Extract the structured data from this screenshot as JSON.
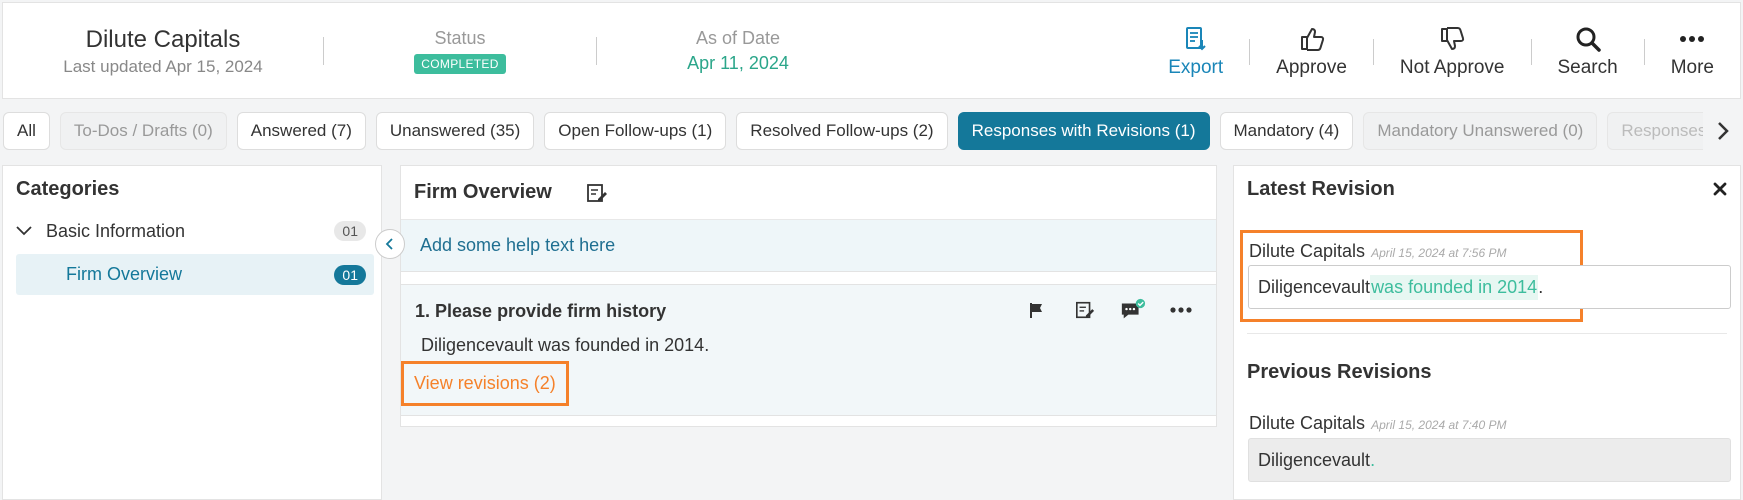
{
  "header": {
    "company": "Dilute Capitals",
    "last_updated": "Last updated Apr 15, 2024",
    "status_label": "Status",
    "status_value": "COMPLETED",
    "date_label": "As of Date",
    "date_value": "Apr 11, 2024",
    "actions": {
      "export": "Export",
      "approve": "Approve",
      "not_approve": "Not Approve",
      "search": "Search",
      "more": "More"
    }
  },
  "tabs": [
    {
      "label": "All"
    },
    {
      "label": "To-Dos / Drafts (0)"
    },
    {
      "label": "Answered (7)"
    },
    {
      "label": "Unanswered (35)"
    },
    {
      "label": "Open Follow-ups (1)"
    },
    {
      "label": "Resolved Follow-ups (2)"
    },
    {
      "label": "Responses with Revisions (1)"
    },
    {
      "label": "Mandatory (4)"
    },
    {
      "label": "Mandatory Unanswered (0)"
    },
    {
      "label": "Responses"
    }
  ],
  "categories": {
    "title": "Categories",
    "group": {
      "name": "Basic Information",
      "count": "01"
    },
    "item": {
      "name": "Firm Overview",
      "count": "01"
    }
  },
  "section": {
    "title": "Firm Overview",
    "help_text": "Add some help text here",
    "question": {
      "title": "1.  Please provide firm history",
      "answer": "Diligencevault was founded in 2014.",
      "revisions_link": "View revisions (2)"
    }
  },
  "revisions": {
    "latest_title": "Latest Revision",
    "latest": {
      "author": "Dilute Capitals",
      "time": "April 15, 2024 at 7:56 PM",
      "text_plain": "Diligencevault",
      "text_added": " was founded in 2014",
      "text_end": "."
    },
    "previous_title": "Previous Revisions",
    "previous": {
      "author": "Dilute Capitals",
      "time": "April 15, 2024 at 7:40 PM",
      "text_plain": "Diligencevault",
      "text_end": "."
    }
  },
  "colors": {
    "accent": "#14789a",
    "success": "#3dbd9d",
    "highlight_box": "#f5812a"
  }
}
